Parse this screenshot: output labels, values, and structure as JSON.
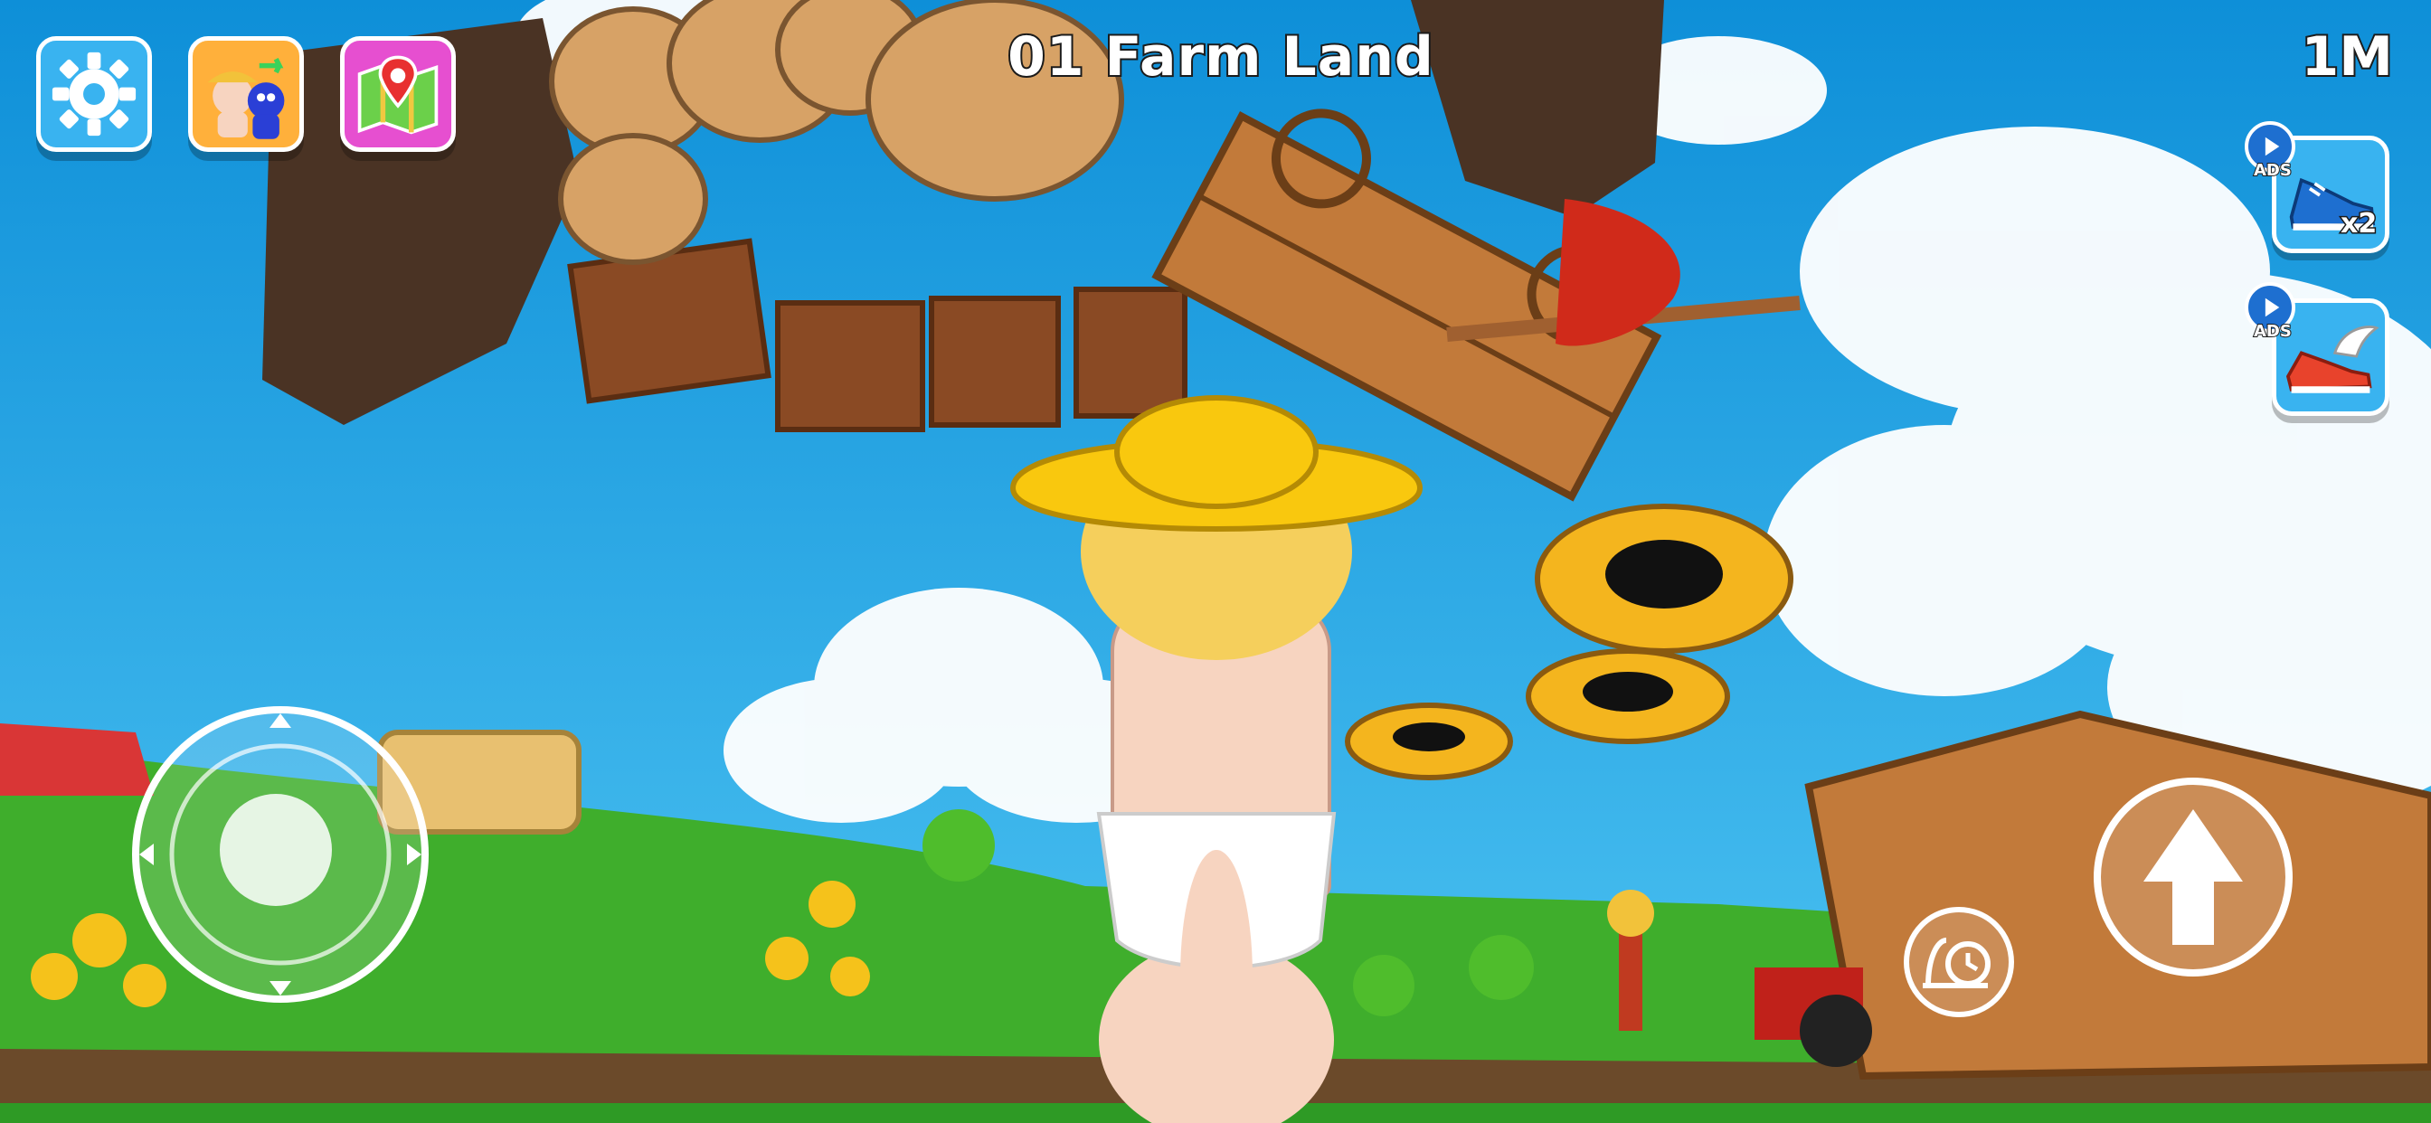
{
  "hud": {
    "settings_icon": "gear-icon",
    "character_icon": "character-swap-icon",
    "map_icon": "map-pin-icon",
    "level_title": "01 Farm Land",
    "distance": "1M"
  },
  "boosts": [
    {
      "name": "speed-shoe",
      "ads_label": "ADS",
      "multiplier": "x2",
      "color": "#1e6fd0"
    },
    {
      "name": "winged-shoe",
      "ads_label": "ADS",
      "color": "#e8432c"
    }
  ],
  "controls": {
    "joystick_icon": "joystick-icon",
    "jump_icon": "arrow-up-icon",
    "slow_icon": "snail-clock-icon"
  },
  "colors": {
    "sky": "#1aa6e6",
    "grass": "#3fae2c",
    "button_blue": "#39b3f0",
    "button_orange": "#ffb03b",
    "button_pink": "#e64fd0"
  }
}
